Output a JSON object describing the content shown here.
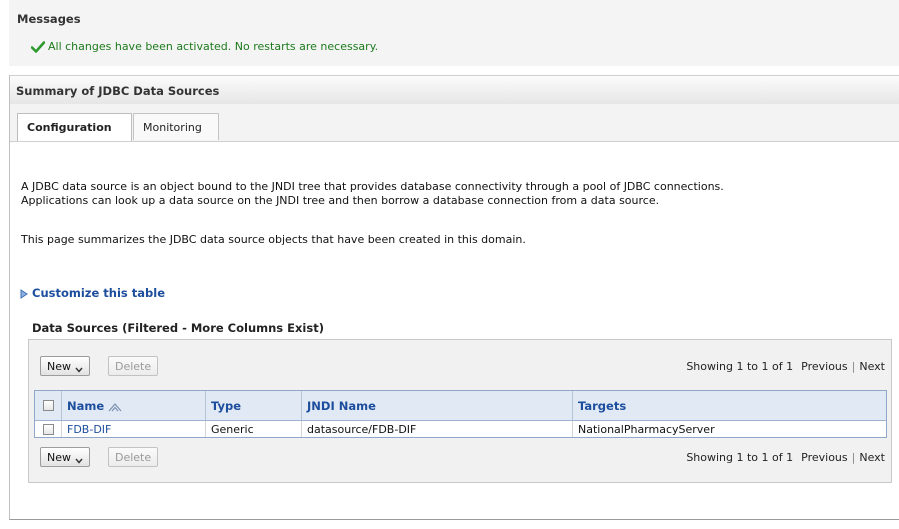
{
  "messages": {
    "title": "Messages",
    "text": "All changes have been activated. No restarts are necessary."
  },
  "summary": {
    "title": "Summary of JDBC Data Sources"
  },
  "tabs": [
    {
      "label": "Configuration",
      "active": true
    },
    {
      "label": "Monitoring",
      "active": false
    }
  ],
  "description": {
    "line1": "A JDBC data source is an object bound to the JNDI tree that provides database connectivity through a pool of JDBC connections.",
    "line2": "Applications can look up a data source on the JNDI tree and then borrow a database connection from a data source.",
    "line3": "This page summarizes the JDBC data source objects that have been created in this domain."
  },
  "customize": {
    "label": "Customize this table"
  },
  "datasources": {
    "title": "Data Sources (Filtered - More Columns Exist)",
    "toolbar": {
      "new_label": "New",
      "delete_label": "Delete"
    },
    "paging": {
      "showing": "Showing 1 to 1 of 1",
      "previous": "Previous",
      "separator": "|",
      "next": "Next"
    },
    "columns": [
      "Name",
      "Type",
      "JNDI Name",
      "Targets"
    ],
    "rows": [
      {
        "name": "FDB-DIF",
        "type": "Generic",
        "jndi": "datasource/FDB-DIF",
        "targets": "NationalPharmacyServer"
      }
    ]
  },
  "colors": {
    "link": "#1c4e9d",
    "success": "#1c7a1c",
    "header_bg": "#e1e9f5"
  }
}
